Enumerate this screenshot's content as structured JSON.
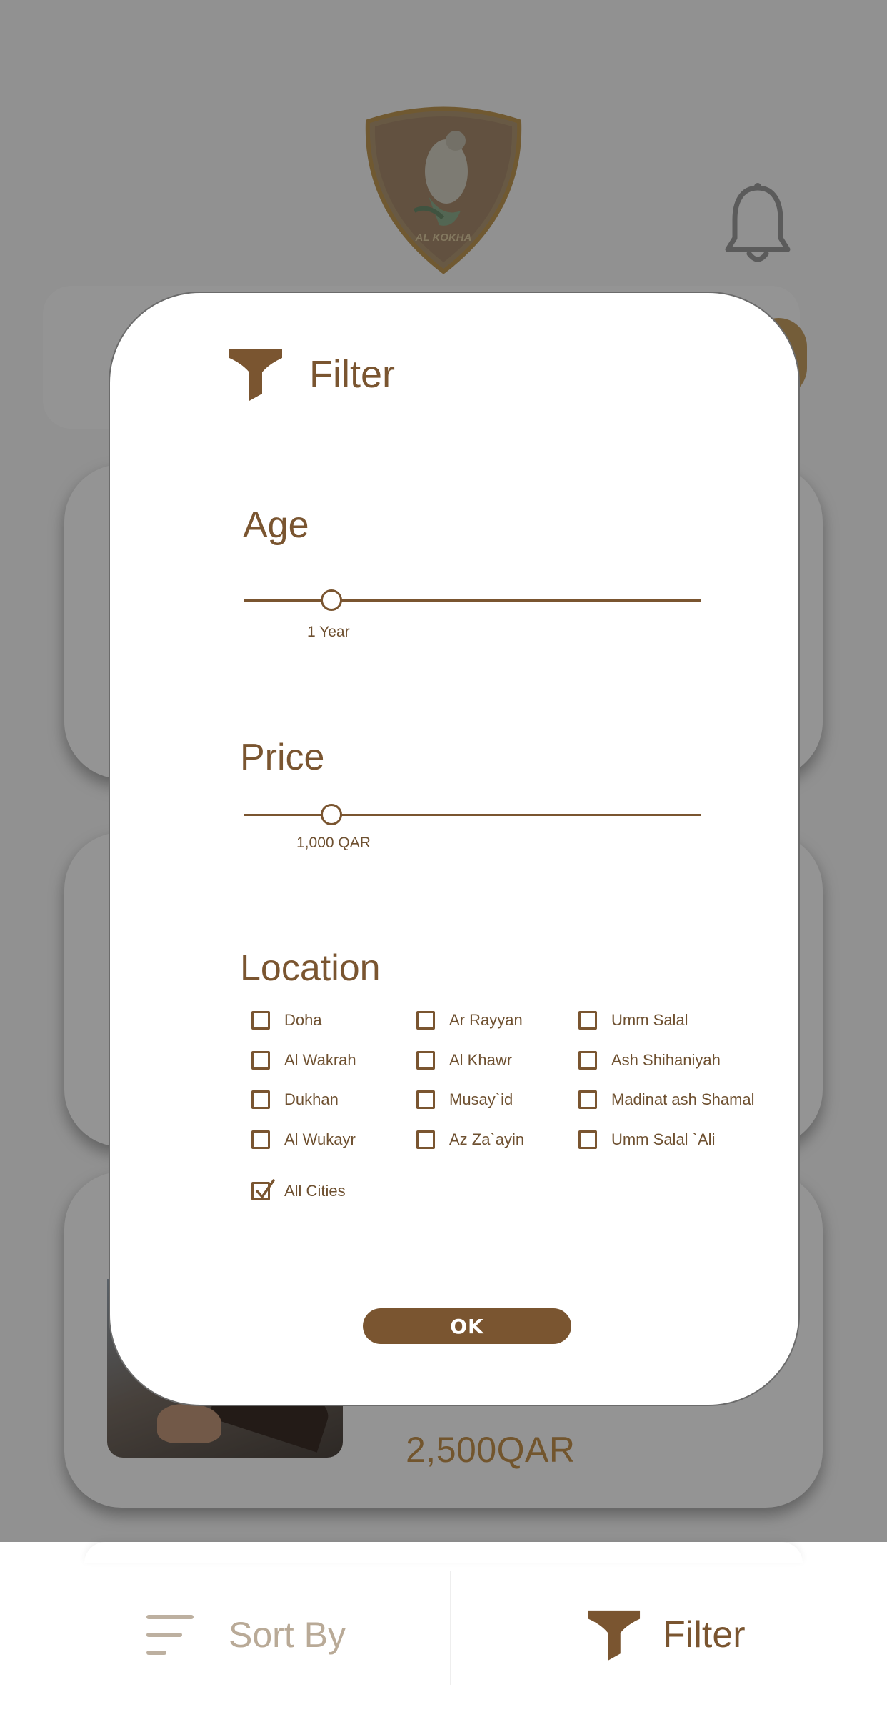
{
  "header": {
    "logo_text": "AL KOKHA"
  },
  "background_cards": {
    "price": "2,500QAR"
  },
  "filter_modal": {
    "title": "Filter",
    "age": {
      "title": "Age",
      "value_label": "1 Year",
      "slider_fraction": 0.19
    },
    "price": {
      "title": "Price",
      "value_label": "1,000 QAR",
      "slider_fraction": 0.19
    },
    "location": {
      "title": "Location",
      "options": [
        {
          "label": "Doha",
          "checked": false
        },
        {
          "label": "Ar Rayyan",
          "checked": false
        },
        {
          "label": "Umm Salal",
          "checked": false
        },
        {
          "label": "Al Wakrah",
          "checked": false
        },
        {
          "label": "Al Khawr",
          "checked": false
        },
        {
          "label": "Ash Shihaniyah",
          "checked": false
        },
        {
          "label": "Dukhan",
          "checked": false
        },
        {
          "label": "Musay`id",
          "checked": false
        },
        {
          "label": "Madinat ash Shamal",
          "checked": false
        },
        {
          "label": "Al Wukayr",
          "checked": false
        },
        {
          "label": "Az Za`ayin",
          "checked": false
        },
        {
          "label": "Umm Salal `Ali",
          "checked": false
        },
        {
          "label": "All Cities",
          "checked": true
        }
      ]
    },
    "ok_label": "OK"
  },
  "bottom_bar": {
    "sort_label": "Sort By",
    "filter_label": "Filter"
  },
  "colors": {
    "brand_brown": "#7a5530",
    "gold": "#c5934f",
    "scrim": "rgba(0,0,0,0.42)"
  }
}
